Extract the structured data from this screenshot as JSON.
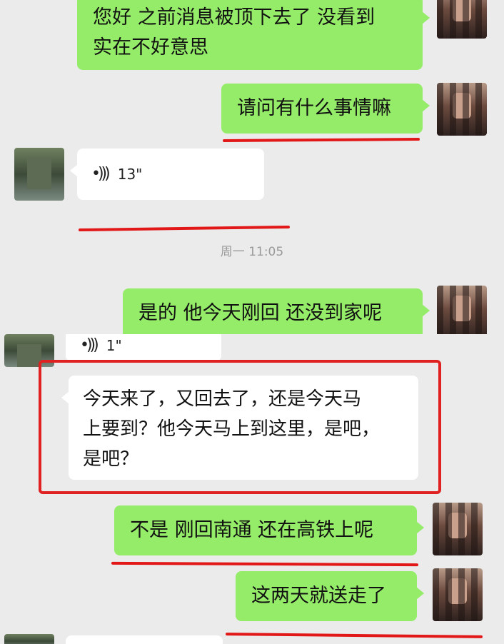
{
  "messages": [
    {
      "side": "right",
      "lines": "您好 之前消息被顶下去了 没看到\n实在不好意思"
    },
    {
      "side": "right",
      "lines": "请问有什么事情嘛"
    },
    {
      "side": "left",
      "voice": "13\""
    },
    {
      "side": "right",
      "lines": "是的 他今天刚回 还没到家呢"
    },
    {
      "side": "left",
      "voice": "1\""
    },
    {
      "side": "left",
      "lines": "今天来了，又回去了，还是今天马\n上要到？他今天马上到这里，是吧，\n是吧？"
    },
    {
      "side": "right",
      "lines": "不是 刚回南通 还在高铁上呢"
    },
    {
      "side": "right",
      "lines": "这两天就送走了"
    }
  ],
  "timestamp": "周一 11:05",
  "colors": {
    "sent_bubble": "#95ec69",
    "received_bubble": "#ffffff",
    "highlight": "#e21818"
  },
  "icons": {
    "voice": "voice-wave-icon"
  }
}
